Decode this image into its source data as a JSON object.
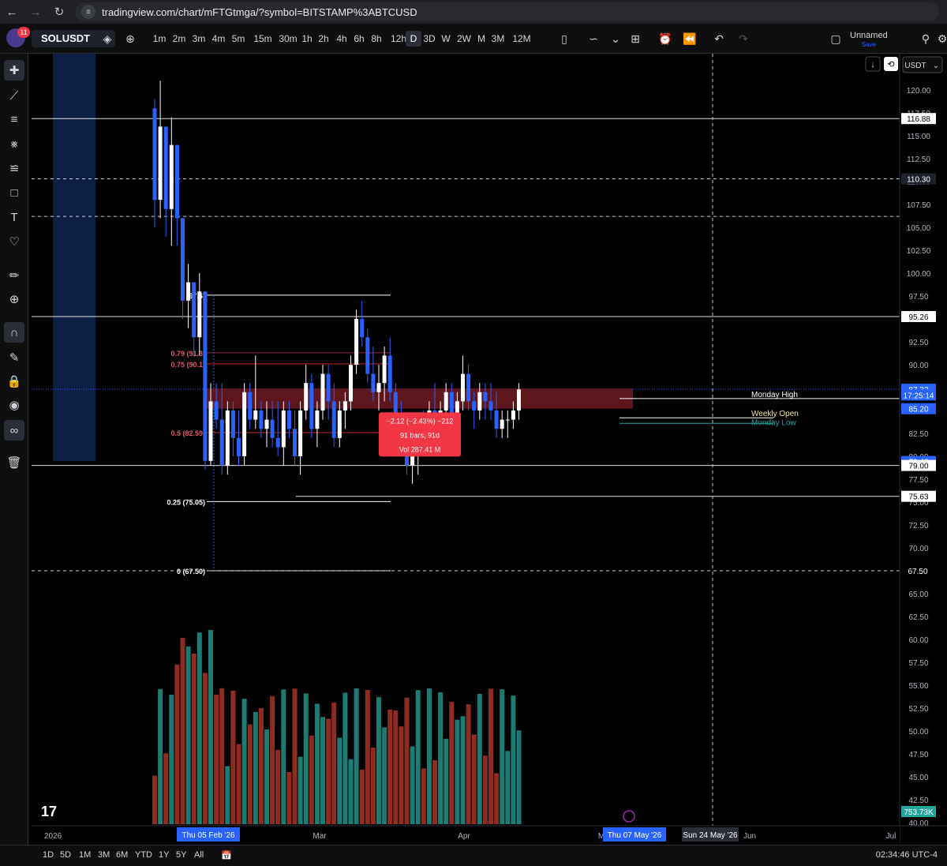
{
  "browser": {
    "url": "tradingview.com/chart/mFTGtmga/?symbol=BITSTAMP%3ABTCUSD"
  },
  "toolbar": {
    "symbol": "SOLUSDT",
    "notifications": "11",
    "timeframes": [
      "1m",
      "2m",
      "3m",
      "4m",
      "5m",
      "15m",
      "30m",
      "1h",
      "2h",
      "4h",
      "6h",
      "8h",
      "12h",
      "D",
      "3D",
      "W",
      "2W",
      "M",
      "3M",
      "12M"
    ],
    "active_timeframe": "D",
    "layout_name": "Unnamed",
    "layout_sub": "Save"
  },
  "scale": {
    "currency": "USDT",
    "ticks": [
      "120.00",
      "117.50",
      "115.00",
      "112.50",
      "110.00",
      "107.50",
      "105.00",
      "102.50",
      "100.00",
      "97.50",
      "92.50",
      "90.00",
      "82.50",
      "80.00",
      "77.50",
      "75.00",
      "72.50",
      "70.00",
      "65.00",
      "62.50",
      "60.00",
      "57.50",
      "55.00",
      "52.50",
      "50.00",
      "47.50",
      "45.00",
      "42.50",
      "40.00"
    ],
    "badges": [
      {
        "label": "116.88",
        "value": 116.88,
        "style": "white"
      },
      {
        "label": "110.30",
        "value": 110.3,
        "style": "dark"
      },
      {
        "label": "95.26",
        "value": 95.26,
        "style": "white"
      },
      {
        "label": "87.32",
        "value": 87.32,
        "style": "blue"
      },
      {
        "label": "17:25:14",
        "value": 86.7,
        "style": "blue"
      },
      {
        "label": "85.20",
        "value": 85.2,
        "style": "blue"
      },
      {
        "label": "79.43",
        "value": 79.43,
        "style": "blue"
      },
      {
        "label": "79.00",
        "value": 79.0,
        "style": "white"
      },
      {
        "label": "75.63",
        "value": 75.63,
        "style": "white"
      },
      {
        "label": "67.50",
        "value": 67.5,
        "style": "none"
      },
      {
        "label": "753.73K",
        "value": 0,
        "style": "green"
      }
    ]
  },
  "time_axis": {
    "labels": [
      "2026",
      "Mar",
      "Apr",
      "M",
      "Jun",
      "Jul"
    ],
    "highlight_labels": [
      "Thu 05 Feb '26",
      "Thu 07 May '26",
      "Sun 24 May '26"
    ]
  },
  "drawings": {
    "fib": [
      {
        "label": "1 (97.6)",
        "value": 97.6,
        "color": "#ffffff"
      },
      {
        "label": "0.79 (91.3)",
        "value": 91.3,
        "color": "#8f2a44"
      },
      {
        "label": "0.75 (90.1)",
        "value": 90.1,
        "color": "#c62828"
      },
      {
        "label": "0.5 (82.59)",
        "value": 82.59,
        "color": "#c62828"
      },
      {
        "label": "0.25 (75.05)",
        "value": 75.05,
        "color": "#ffffff"
      },
      {
        "label": "0 (67.50)",
        "value": 67.5,
        "color": "#ffffff"
      }
    ],
    "zone_labels": {
      "monday_high": "Monday High",
      "weekly_open": "Weekly Open",
      "monday_low": "Monday Low"
    },
    "measure": {
      "line1": "−2.12 (−2.43%) −212",
      "line2": "91 bars, 91d",
      "line3": "Vol 287.41 M"
    }
  },
  "bottom": {
    "ranges": [
      "1D",
      "5D",
      "1M",
      "3M",
      "6M",
      "YTD",
      "1Y",
      "5Y",
      "All"
    ],
    "clock": "02:34:46 UTC-4"
  },
  "chart_data": {
    "type": "candlestick",
    "symbol": "SOLUSDT",
    "interval": "D",
    "ylim": [
      40,
      121
    ],
    "grid": false,
    "candles": [
      [
        118,
        119,
        105,
        108
      ],
      [
        108,
        121,
        106,
        116
      ],
      [
        116,
        116,
        104,
        107
      ],
      [
        107,
        117,
        103,
        114
      ],
      [
        114,
        114,
        103,
        106
      ],
      [
        106,
        106,
        95,
        97
      ],
      [
        97,
        101,
        94,
        99
      ],
      [
        99,
        99,
        91,
        93
      ],
      [
        93,
        100,
        91,
        98
      ],
      [
        98,
        98,
        78.5,
        79.5
      ],
      [
        79.5,
        88,
        79,
        86
      ],
      [
        86,
        88,
        83,
        84
      ],
      [
        84,
        88,
        78,
        79
      ],
      [
        79,
        86,
        78,
        85
      ],
      [
        85,
        86,
        80,
        82
      ],
      [
        82,
        85,
        79,
        80
      ],
      [
        80,
        88,
        79,
        87
      ],
      [
        87,
        88,
        83,
        84
      ],
      [
        84,
        91,
        83,
        85
      ],
      [
        85,
        86,
        82,
        83
      ],
      [
        83,
        86,
        81,
        84
      ],
      [
        84,
        86,
        81,
        82
      ],
      [
        82,
        86,
        80,
        81
      ],
      [
        81,
        86,
        79,
        85
      ],
      [
        85,
        86,
        82,
        83
      ],
      [
        83,
        85,
        79,
        80
      ],
      [
        80,
        86,
        78,
        85
      ],
      [
        85,
        90,
        84,
        88
      ],
      [
        88,
        89,
        82,
        83
      ],
      [
        83,
        86,
        81,
        85
      ],
      [
        85,
        90,
        84,
        89
      ],
      [
        89,
        90,
        84,
        86
      ],
      [
        86,
        88,
        81,
        82
      ],
      [
        82,
        86,
        81,
        85
      ],
      [
        85,
        87,
        83,
        86
      ],
      [
        86,
        91,
        85,
        90
      ],
      [
        90,
        96,
        89,
        95
      ],
      [
        95,
        97,
        92,
        93
      ],
      [
        93,
        94,
        88,
        89
      ],
      [
        89,
        92,
        86,
        87
      ],
      [
        87,
        90,
        85,
        88
      ],
      [
        88,
        92,
        86,
        91
      ],
      [
        91,
        93,
        86,
        87
      ],
      [
        87,
        88,
        83,
        84
      ],
      [
        84,
        86,
        81,
        82
      ],
      [
        82,
        83,
        78,
        79
      ],
      [
        79,
        82,
        77,
        80
      ],
      [
        80,
        84,
        78,
        83
      ],
      [
        83,
        85,
        80,
        81
      ],
      [
        81,
        86,
        80,
        85
      ],
      [
        85,
        88,
        83,
        84
      ],
      [
        84,
        86,
        82,
        85
      ],
      [
        85,
        88,
        84,
        87
      ],
      [
        87,
        88,
        83,
        84
      ],
      [
        84,
        87,
        83,
        86
      ],
      [
        86,
        91,
        85,
        89
      ],
      [
        89,
        90,
        85,
        86
      ],
      [
        86,
        87,
        83,
        85
      ],
      [
        85,
        88,
        84,
        87
      ],
      [
        87,
        88,
        84,
        86
      ],
      [
        86,
        88,
        84,
        85
      ],
      [
        85,
        87,
        82,
        83
      ],
      [
        83,
        85,
        82,
        84
      ],
      [
        84,
        85,
        82,
        84
      ],
      [
        84,
        86,
        83,
        85
      ],
      [
        85,
        88,
        84,
        87.3
      ]
    ],
    "volume_max_value": 753.73
  }
}
